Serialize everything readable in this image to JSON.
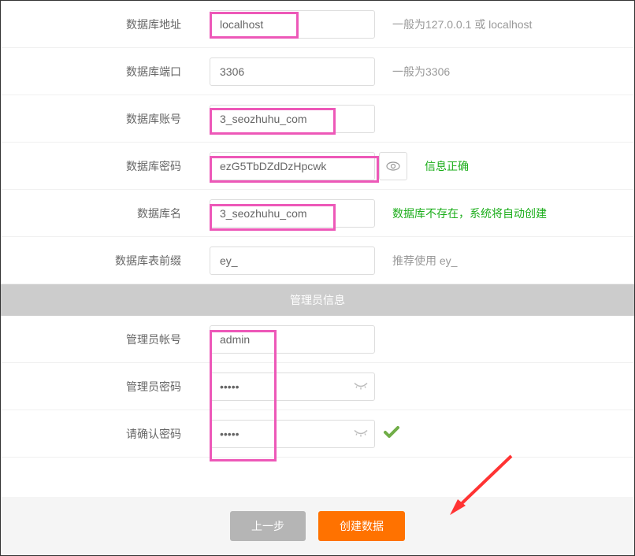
{
  "db": {
    "address_label": "数据库地址",
    "address_value": "localhost",
    "address_hint": "一般为127.0.0.1 或 localhost",
    "port_label": "数据库端口",
    "port_value": "3306",
    "port_hint": "一般为3306",
    "account_label": "数据库账号",
    "account_value": "3_seozhuhu_com",
    "password_label": "数据库密码",
    "password_value": "ezG5TbDZdDzHpcwk",
    "password_hint": "信息正确",
    "name_label": "数据库名",
    "name_value": "3_seozhuhu_com",
    "name_hint": "数据库不存在，系统将自动创建",
    "prefix_label": "数据库表前缀",
    "prefix_value": "ey_",
    "prefix_hint": "推荐使用 ey_"
  },
  "admin_section_title": "管理员信息",
  "admin": {
    "account_label": "管理员帐号",
    "account_value": "admin",
    "password_label": "管理员密码",
    "password_value": "•••••",
    "confirm_label": "请确认密码",
    "confirm_value": "•••••"
  },
  "footer": {
    "prev_label": "上一步",
    "create_label": "创建数据"
  }
}
